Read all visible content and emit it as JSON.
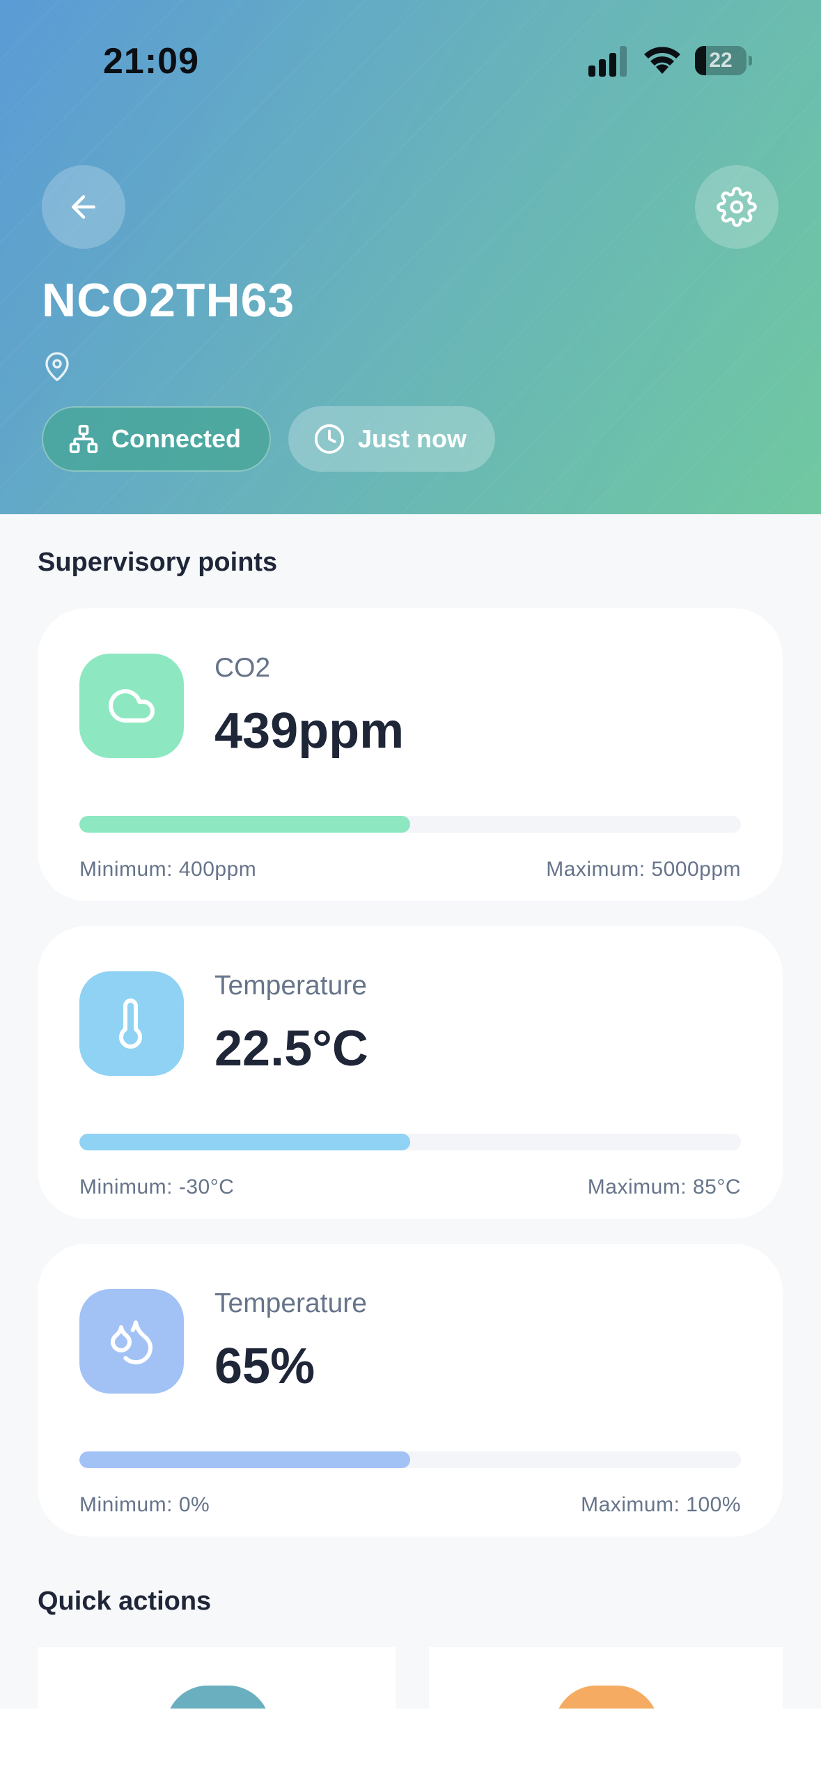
{
  "status_bar": {
    "time": "21:09",
    "battery_level": "22",
    "battery_fraction": 0.22
  },
  "header": {
    "device_name": "NCO2TH63",
    "back_icon": "arrow-left-icon",
    "settings_icon": "gear-icon",
    "location_icon": "map-pin-icon",
    "connection_label": "Connected",
    "connection_icon": "network-icon",
    "last_update_label": "Just now",
    "last_update_icon": "clock-icon"
  },
  "supervisory": {
    "title": "Supervisory points",
    "points": [
      {
        "label": "CO2",
        "value": "439ppm",
        "icon": "cloud-icon",
        "color": "#8de8c2",
        "bar_color": "#8de8c2",
        "level": 0.5,
        "min_label": "Minimum: 400ppm",
        "max_label": "Maximum: 5000ppm"
      },
      {
        "label": "Temperature",
        "value": "22.5°C",
        "icon": "thermometer-icon",
        "color": "#8fd2f4",
        "bar_color": "#8fd2f4",
        "level": 0.5,
        "min_label": "Minimum: -30°C",
        "max_label": "Maximum: 85°C"
      },
      {
        "label": "Temperature",
        "value": "65%",
        "icon": "droplets-icon",
        "color": "#a2c2f6",
        "bar_color": "#a2c2f6",
        "level": 0.5,
        "min_label": "Minimum: 0%",
        "max_label": "Maximum: 100%"
      }
    ]
  },
  "quick_actions": {
    "title": "Quick actions",
    "colors": [
      "#6aafc0",
      "#f5ac62"
    ]
  }
}
